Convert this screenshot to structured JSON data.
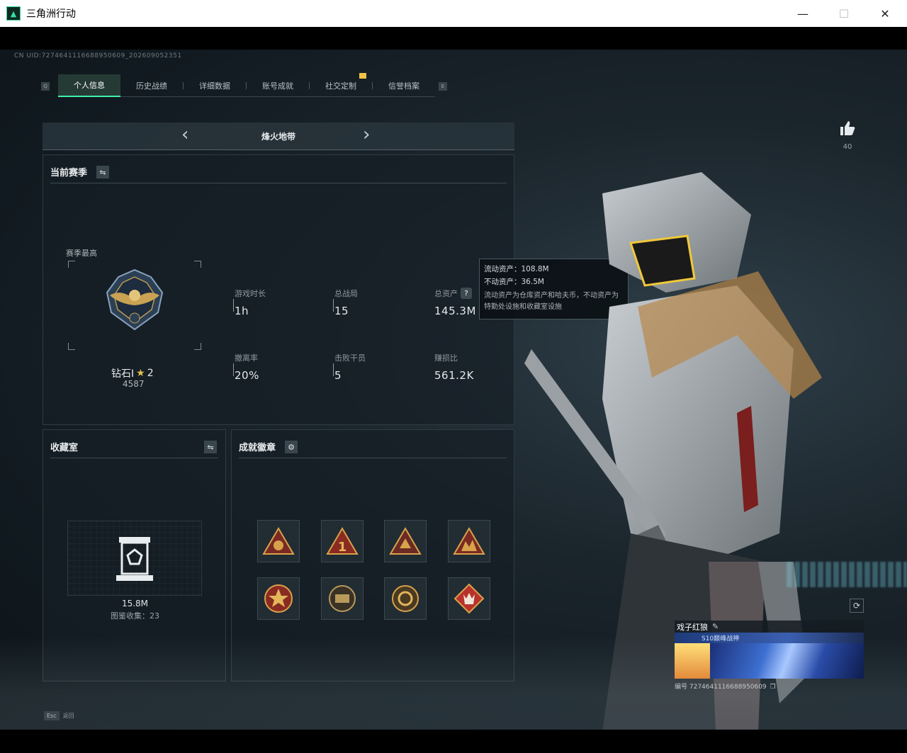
{
  "window": {
    "title": "三角洲行动",
    "minimize": "—",
    "maximize": "☐",
    "close": "✕"
  },
  "uid": "CN UID:7274641116688950609_202609052351",
  "tabs": [
    {
      "label": "个人信息",
      "active": true
    },
    {
      "label": "历史战绩"
    },
    {
      "label": "详细数据"
    },
    {
      "label": "账号成就"
    },
    {
      "label": "社交定制"
    },
    {
      "label": "信誉档案"
    }
  ],
  "tab_keys": {
    "left": "Q",
    "right": "E"
  },
  "mode": {
    "title": "烽火地带",
    "prev": "‹",
    "next": "›"
  },
  "season": {
    "title": "当前赛季",
    "swap_icon": "⇋",
    "best_label": "赛季最高",
    "rank_name": "钻石I",
    "rank_stars": "2",
    "rank_score": "4587",
    "stats": [
      {
        "label": "游戏时长",
        "value": "1h"
      },
      {
        "label": "总战局",
        "value": "15"
      },
      {
        "label": "总资产",
        "value": "145.3M",
        "help": "?"
      },
      {
        "label": "撤离率",
        "value": "20%"
      },
      {
        "label": "击败干员",
        "value": "5"
      },
      {
        "label": "赚损比",
        "value": "561.2K"
      }
    ]
  },
  "tooltip": {
    "liquid": "流动资产：108.8M",
    "fixed": "不动资产：36.5M",
    "note": "流动资产为仓库资产和哈夫币，不动资产为特勤处设施和收藏室设施"
  },
  "collection": {
    "title": "收藏室",
    "swap_icon": "⇋",
    "value": "15.8M",
    "count_label": "图鉴收集：23"
  },
  "achievements": {
    "title": "成就徽章",
    "gear_icon": "⚙",
    "badges": [
      "badge-1",
      "badge-2",
      "badge-3",
      "badge-4",
      "badge-5",
      "badge-6",
      "badge-7",
      "badge-8"
    ]
  },
  "likes": {
    "count": "40"
  },
  "player": {
    "name": "戏子红狼",
    "edit_icon": "✎",
    "title": "S10巅峰战神",
    "id_label": "编号 7274641116688950609"
  },
  "refresh_icon": "⟳",
  "esc": {
    "key": "Esc",
    "label": "返回"
  },
  "colors": {
    "accent": "#3ef0a8",
    "badge_gold": "#d8a24a",
    "badge_red": "#b8322c"
  }
}
